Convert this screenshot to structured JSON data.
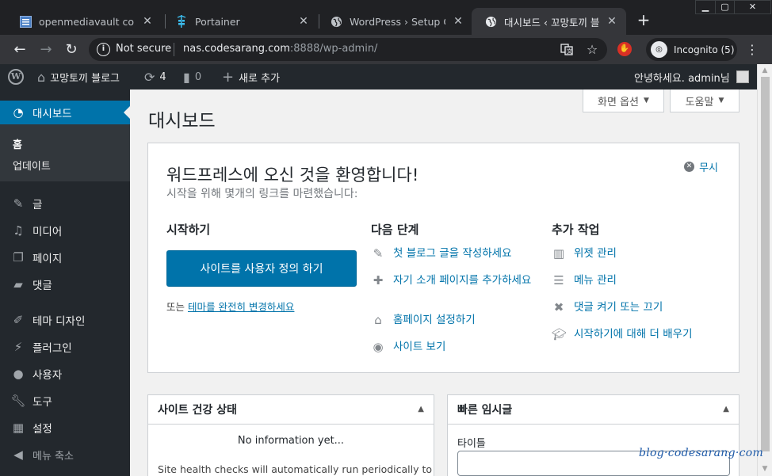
{
  "browser": {
    "tabs": [
      {
        "title": "openmediavault control",
        "icon": "omv-icon"
      },
      {
        "title": "Portainer",
        "icon": "portainer-icon"
      },
      {
        "title": "WordPress › Setup Confi",
        "icon": "globe-icon"
      },
      {
        "title": "대시보드 ‹ 꼬망토끼 블로",
        "icon": "globe-icon",
        "active": true
      }
    ],
    "window_controls": [
      "minimize",
      "maximize",
      "close"
    ],
    "security_text": "Not secure",
    "url_host": "nas.codesarang.com",
    "url_rest": ":8888/wp-admin/",
    "incognito_label": "Incognito (5)"
  },
  "adminbar": {
    "site_name": "꼬망토끼 블로그",
    "updates_count": "4",
    "comments_count": "0",
    "new_label": "새로 추가",
    "greeting": "안녕하세요. admin님"
  },
  "sidebar": {
    "current": "대시보드",
    "submenu": [
      "홈",
      "업데이트"
    ],
    "items": [
      {
        "label": "글",
        "icon": "pin-icon"
      },
      {
        "label": "미디어",
        "icon": "media-icon"
      },
      {
        "label": "페이지",
        "icon": "page-icon"
      },
      {
        "label": "댓글",
        "icon": "comment-icon"
      },
      {
        "label": "테마 디자인",
        "icon": "brush-icon"
      },
      {
        "label": "플러그인",
        "icon": "plugin-icon"
      },
      {
        "label": "사용자",
        "icon": "user-icon"
      },
      {
        "label": "도구",
        "icon": "wrench-icon"
      },
      {
        "label": "설정",
        "icon": "settings-icon"
      }
    ],
    "collapse_label": "메뉴 축소"
  },
  "content": {
    "screen_options": "화면 옵션",
    "help": "도움말",
    "page_title": "대시보드",
    "welcome": {
      "heading": "워드프레스에 오신 것을 환영합니다!",
      "subheading": "시작을 위해 몇개의 링크를 마련했습니다:",
      "dismiss": "무시",
      "col1_title": "시작하기",
      "cta_button": "사이트를 사용자 정의 하기",
      "or_prefix": "또는 ",
      "or_link": "테마를 완전히 변경하세요",
      "col2_title": "다음 단계",
      "next_steps": [
        {
          "label": "첫 블로그 글을 작성하세요",
          "icon": "edit-icon"
        },
        {
          "label": "자기 소개 페이지를 추가하세요",
          "icon": "plus-icon"
        },
        {
          "label": "홈페이지 설정하기",
          "icon": "home-icon"
        },
        {
          "label": "사이트 보기",
          "icon": "view-icon"
        }
      ],
      "col3_title": "추가 작업",
      "more_actions": [
        {
          "label": "위젯 관리",
          "icon": "widgets-icon"
        },
        {
          "label": "메뉴 관리",
          "icon": "menu-list-icon"
        },
        {
          "label": "댓글 켜기 또는 끄기",
          "icon": "comment-toggle-icon"
        },
        {
          "label": "시작하기에 대해 더 배우기",
          "icon": "learn-icon"
        }
      ]
    },
    "site_health": {
      "title": "사이트 건강 상태",
      "status": "No information yet...",
      "desc": "Site health checks will automatically run periodically to"
    },
    "quick_draft": {
      "title": "빠른 임시글",
      "title_label": "타이틀"
    }
  },
  "watermark": "blog·codesarang·com"
}
